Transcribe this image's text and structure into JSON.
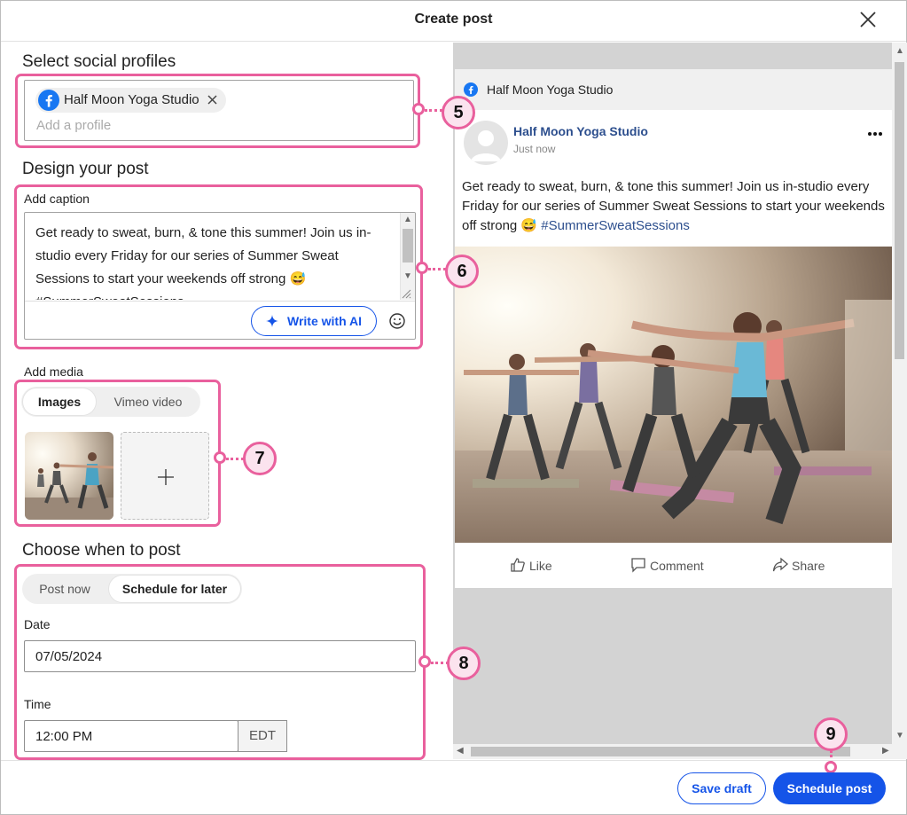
{
  "header": {
    "title": "Create post",
    "close_icon": "close-icon"
  },
  "profiles": {
    "heading": "Select social profiles",
    "selected": [
      {
        "name": "Half Moon Yoga Studio",
        "network_icon": "facebook-icon"
      }
    ],
    "placeholder": "Add a profile"
  },
  "design": {
    "heading": "Design your post",
    "caption_label": "Add caption",
    "caption_text": "Get ready to sweat, burn, & tone this summer! Join us in-studio every Friday for our series of Summer Sweat Sessions to start your weekends off strong 😅 #SummerSweatSessions",
    "ai_button": "Write with AI",
    "media_label": "Add media",
    "media_tabs": [
      {
        "label": "Images",
        "active": true
      },
      {
        "label": "Vimeo video",
        "active": false
      }
    ]
  },
  "schedule": {
    "heading": "Choose when to post",
    "tabs": [
      {
        "label": "Post now",
        "active": false
      },
      {
        "label": "Schedule for later",
        "active": true
      }
    ],
    "date_label": "Date",
    "date_value": "07/05/2024",
    "time_label": "Time",
    "time_value": "12:00 PM",
    "timezone": "EDT"
  },
  "preview": {
    "page_name": "Half Moon Yoga Studio",
    "post_author": "Half Moon Yoga Studio",
    "post_time": "Just now",
    "post_text": "Get ready to sweat, burn, & tone this summer! Join us in-studio every Friday for our series of Summer Sweat Sessions to start your weekends off strong 😅 ",
    "post_hashtag": "#SummerSweatSessions",
    "actions": {
      "like": "Like",
      "comment": "Comment",
      "share": "Share"
    }
  },
  "callouts": [
    "5",
    "6",
    "7",
    "8",
    "9"
  ],
  "footer": {
    "save_draft": "Save draft",
    "schedule_post": "Schedule post"
  },
  "colors": {
    "accent": "#1554e8",
    "highlight": "#e9609d",
    "facebook": "#1877f2",
    "link": "#2d4f8e"
  }
}
